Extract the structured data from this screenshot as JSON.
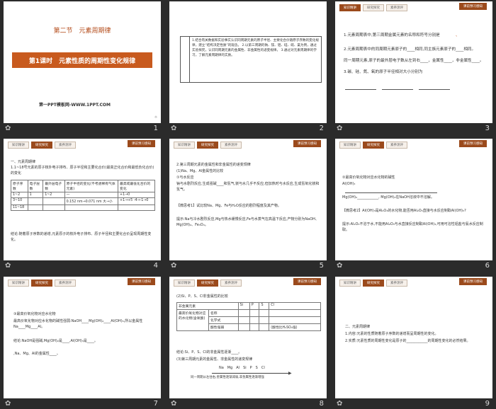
{
  "slides": {
    "s1": {
      "section": "第二节　元素周期律",
      "lesson": "第1课时　元素性质的周期性变化规律",
      "footer_text": "第一PPT模板网-WWW.1PPT.COM",
      "number": "1"
    },
    "s2": {
      "objectives": "1.结合有关数据和实验事实认识同周期元素的原子半径、主要化合价随原子序数的变化规律，建立“结构决定性质”的观念。 2.以第三周期的钠、镁、铝、硅、硫、氯为例，通过实验探究，认识同周期元素的金属性、非金属性的递变规律。 3.通过对元素周期律的学习，了解元素周期律的实质。",
      "number": "2"
    },
    "s3": {
      "tabs": [
        "知识精讲",
        "研究探究",
        "素养测评"
      ],
      "ribbon": "课前预习感知",
      "l1": "1.元素周期表中,第三周期金属元素的名称和符号分别是",
      "l1b": "、",
      "l2": "2.元素周期表中的同周期元素原子的____相同,同主族元素原子的____相同。",
      "l2b": "同一周期元素,原子的最外层电子数从左到右____，金属性____，非金属性____。",
      "l3": "3.碳、硅、氮、氧的原子半径相对大小分别为",
      "number": "3"
    },
    "s4": {
      "tabs": [
        "知识精讲",
        "研究探究",
        "素养测评"
      ],
      "ribbon": "课前预习感知",
      "h1": "一、元素周期律",
      "h2": "1.1~18号元素的原子核外电子排布、原子半径和主要化合价(最高正化合价和最低负化合价)的变化",
      "table": {
        "head": [
          "原子序数",
          "电子层数",
          "最外层电子数",
          "原子半径的变化(不考虑稀有气体元素)",
          "最高或最低化合价的变化"
        ],
        "rows": [
          [
            "1~2",
            "1",
            "1~2",
            "—",
            "+1→0"
          ],
          [
            "3~10",
            "",
            "",
            "0.152 nm→0.071 nm 大→小",
            "+1→+5 -4→-1→0"
          ],
          [
            "11~18",
            "",
            "",
            "",
            ""
          ]
        ]
      },
      "conclusion": "结论:随着原子序数的递增,元素原子的核外电子排布、原子半径和主要化合价呈现周期性变化。",
      "number": "4"
    },
    "s5": {
      "tabs": [
        "知识精讲",
        "研究探究",
        "素养测评"
      ],
      "ribbon": "课前预习感知",
      "p1": "2.第三周期元素的金属性和非金属性的递变规律",
      "p2": "(1)Na、Mg、Al金属性的比较",
      "p3": "①与水反应",
      "p4": "钠与水剧烈反应,生成强碱____和氢气,镁与水几乎不反应,但加热时与水反应,生成氢氧化镁和氢气。",
      "p5": "【微思考1】试比较Na、Mg、Fe与H₂O反应的剧烈程度及其产物。",
      "p6": "提示:Na与冷水剧烈反应,Mg与热水缓慢反应,Fe与水蒸气在高温下反应,产物分别为NaOH、Mg(OH)₂、Fe₃O₄。",
      "number": "5"
    },
    "s6": {
      "tabs": [
        "知识精讲",
        "研究探究",
        "素养测评"
      ],
      "ribbon": "课前预习感知",
      "p1": "②最高价氧化物对应水化物的碱性",
      "p2": "Al(OH)₃",
      "p3": "Mg(OH)₂____________, Mg(OH)₂在NaOH溶液中不溶解。",
      "p4": "【微思考2】Al(OH)₃是Al₂O₃的水化物,能否用Al₂O₃直接与水反应制取Al(OH)₃?",
      "p5": "提示:Al₂O₃不溶于水,不能用Al₂O₃与水直接反应制取Al(OH)₃,可用可溶性铝盐与氨水反应制取。",
      "number": "6"
    },
    "s7": {
      "tabs": [
        "知识精讲",
        "研究探究",
        "素养测评"
      ],
      "ribbon": "课前预习感知",
      "p1": "③最高价氧化物对应水化物",
      "p2": "最高价氧化物对应水化物的碱性强弱:NaOH____Mg(OH)₂____Al(OH)₃,所以金属性Na____Mg____Al。",
      "p3": "结论:NaOH是强碱,Mg(OH)₂是____,Al(OH)₃是____。",
      "p4": ",Na、Mg、Al的金属性____。",
      "number": "7"
    },
    "s8": {
      "tabs": [
        "知识精讲",
        "研究探究",
        "素养测评"
      ],
      "ribbon": "课前预习感知",
      "p1": "(2)Si、P、S、Cl非金属性的比较",
      "head": [
        "非金属元素",
        "Si",
        "P",
        "S",
        "Cl"
      ],
      "r1": [
        "最高价氧化物对应的水化物(含氧酸)",
        "名称",
        "",
        "",
        "",
        ""
      ],
      "r2": [
        "",
        "化学式",
        "",
        "",
        "",
        ""
      ],
      "r3": [
        "",
        "酸性强弱",
        "",
        "",
        "",
        "(酸性比H₂SO₄强)"
      ],
      "p2": "结论:Si、P、S、Cl的非金属性逐渐____。",
      "p3": "(3)第三周期元素的金属性、非金属性的递变规律",
      "seq": "Na　Mg　Al　Si　P　S　Cl",
      "p4": "同一周期从左往右,金属性逐渐减弱,非金属性逐渐增强",
      "number": "8"
    },
    "s9": {
      "tabs": [
        "知识精讲",
        "研究探究",
        "素养测评"
      ],
      "ribbon": "课前预习感知",
      "p1": "二、元素周期律",
      "p2": "1.内容:元素的性质随着原子序数的递增而呈周期性的变化。",
      "p3": "2.实质:元素性质的周期性变化是原子的____________的周期性变化的必然结果。",
      "number": "9"
    }
  },
  "colors": {
    "accent": "#9b4a1c",
    "title_bg": "#c85a1e",
    "highlight": "#c0440e"
  }
}
